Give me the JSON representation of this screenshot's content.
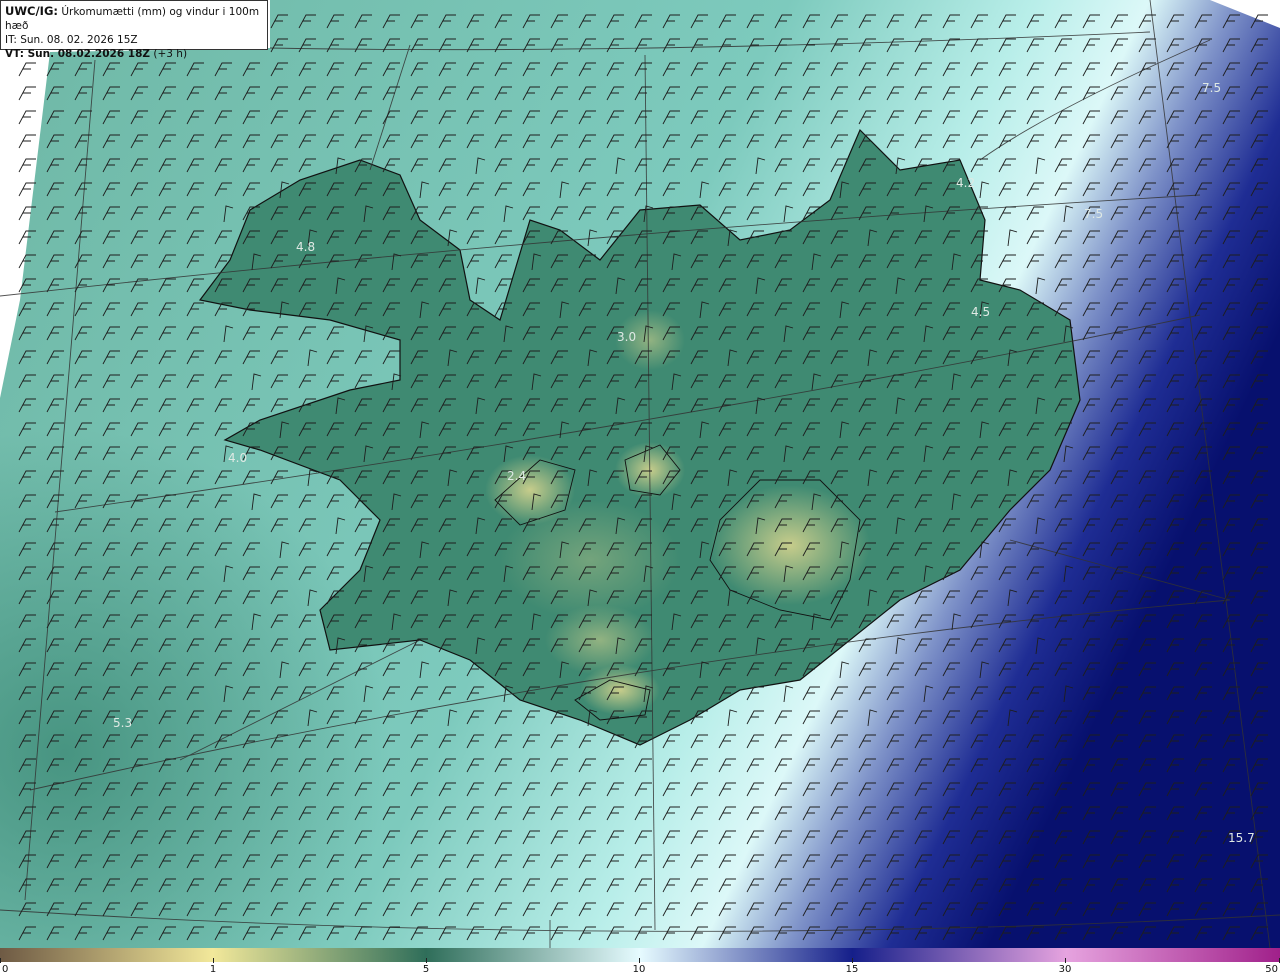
{
  "header": {
    "model_label": "UWC/IG:",
    "title": "Úrkomumætti (mm) og vindur i 100m hæð",
    "initial_time": "IT: Sun. 08. 02. 2026 15Z",
    "valid_label": "VT: Sun. 08.02.2026 18Z",
    "valid_offset": "(+3 h)"
  },
  "map_labels": [
    {
      "text": "4.8",
      "region": "westfjords"
    },
    {
      "text": "3.0",
      "region": "north"
    },
    {
      "text": "4.2",
      "region": "northeast-coast"
    },
    {
      "text": "7.5",
      "region": "northeast-sea"
    },
    {
      "text": "7.5",
      "region": "northeast-sea-outer"
    },
    {
      "text": "4.5",
      "region": "east"
    },
    {
      "text": "4.0",
      "region": "snaefellsnes"
    },
    {
      "text": "2.4",
      "region": "central-west"
    },
    {
      "text": "5.3",
      "region": "southwest-sea"
    },
    {
      "text": "15.7",
      "region": "southeast-sea"
    }
  ],
  "colorbar": {
    "ticks": [
      "0",
      "1",
      "5",
      "10",
      "15",
      "30",
      "50"
    ],
    "colors": {
      "c0": "#6e5a44",
      "c1": "#f2e89a",
      "c5": "#2f6e5a",
      "c10": "#e6fbff",
      "c15": "#151f8a",
      "c30": "#e6a3df",
      "c50": "#a0208a"
    }
  },
  "map": {
    "colors": {
      "sea": "#6fbfb0",
      "sea_light": "#b6ece6",
      "sea_deep": "#0a1a78",
      "land": "#3c8870",
      "highland": "#c8c880",
      "coast": "#111111",
      "grid": "#333333",
      "barb": "#222222"
    }
  }
}
